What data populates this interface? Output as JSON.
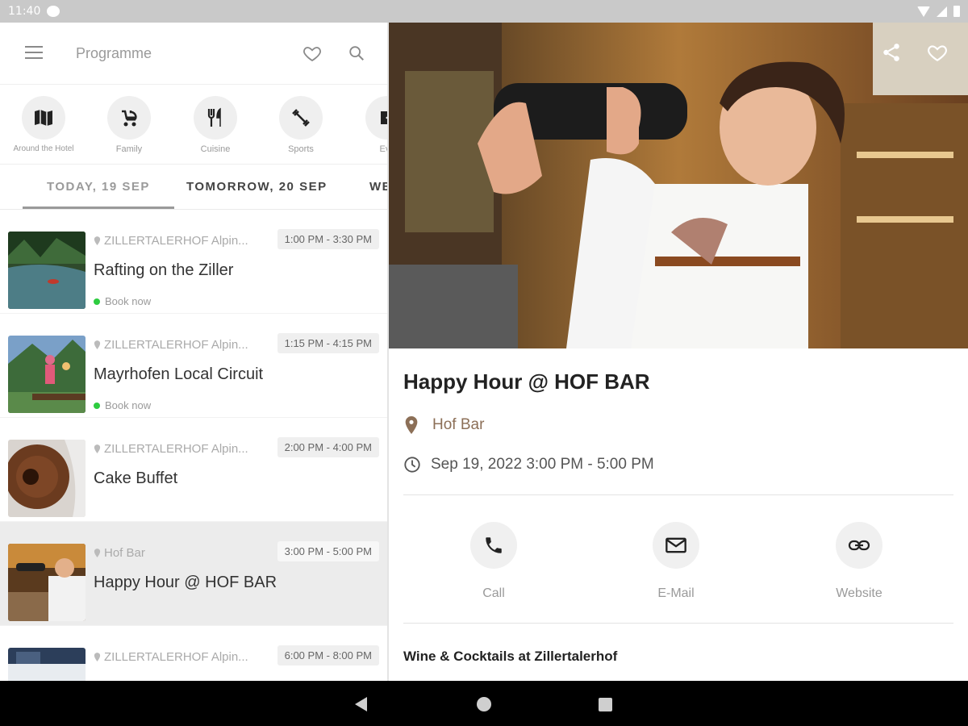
{
  "status_bar": {
    "time": "11:40"
  },
  "header": {
    "title": "Programme"
  },
  "categories": [
    {
      "label": "Around the Hotel",
      "icon": "map-icon"
    },
    {
      "label": "Family",
      "icon": "stroller-icon"
    },
    {
      "label": "Cuisine",
      "icon": "cutlery-icon"
    },
    {
      "label": "Sports",
      "icon": "dumbbell-icon"
    },
    {
      "label": "Eve",
      "icon": "event-icon"
    }
  ],
  "tabs": [
    {
      "label": "TODAY, 19 SEP",
      "active": true
    },
    {
      "label": "TOMORROW, 20 SEP",
      "active": false
    },
    {
      "label": "WE",
      "active": false
    }
  ],
  "events": [
    {
      "location": "ZILLERTALERHOF Alpin...",
      "time": "1:00 PM - 3:30 PM",
      "title": "Rafting on the Ziller",
      "book": "Book now"
    },
    {
      "location": "ZILLERTALERHOF Alpin...",
      "time": "1:15 PM - 4:15 PM",
      "title": "Mayrhofen Local Circuit",
      "book": "Book now"
    },
    {
      "location": "ZILLERTALERHOF Alpin...",
      "time": "2:00 PM - 4:00 PM",
      "title": "Cake Buffet",
      "book": ""
    },
    {
      "location": "Hof Bar",
      "time": "3:00 PM - 5:00 PM",
      "title": "Happy Hour @ HOF BAR",
      "book": "",
      "selected": true
    },
    {
      "location": "ZILLERTALERHOF Alpin...",
      "time": "6:00 PM - 8:00 PM",
      "title": "",
      "book": ""
    }
  ],
  "detail": {
    "title": "Happy Hour @ HOF BAR",
    "location": "Hof Bar",
    "datetime": "Sep 19, 2022 3:00 PM - 5:00 PM",
    "actions": {
      "call": "Call",
      "email": "E-Mail",
      "website": "Website"
    },
    "description_heading": "Wine & Cocktails at Zillertalerhof"
  },
  "colors": {
    "accent_brown": "#8c6f57",
    "book_green": "#2ecc40",
    "selected_row": "#ececec"
  }
}
